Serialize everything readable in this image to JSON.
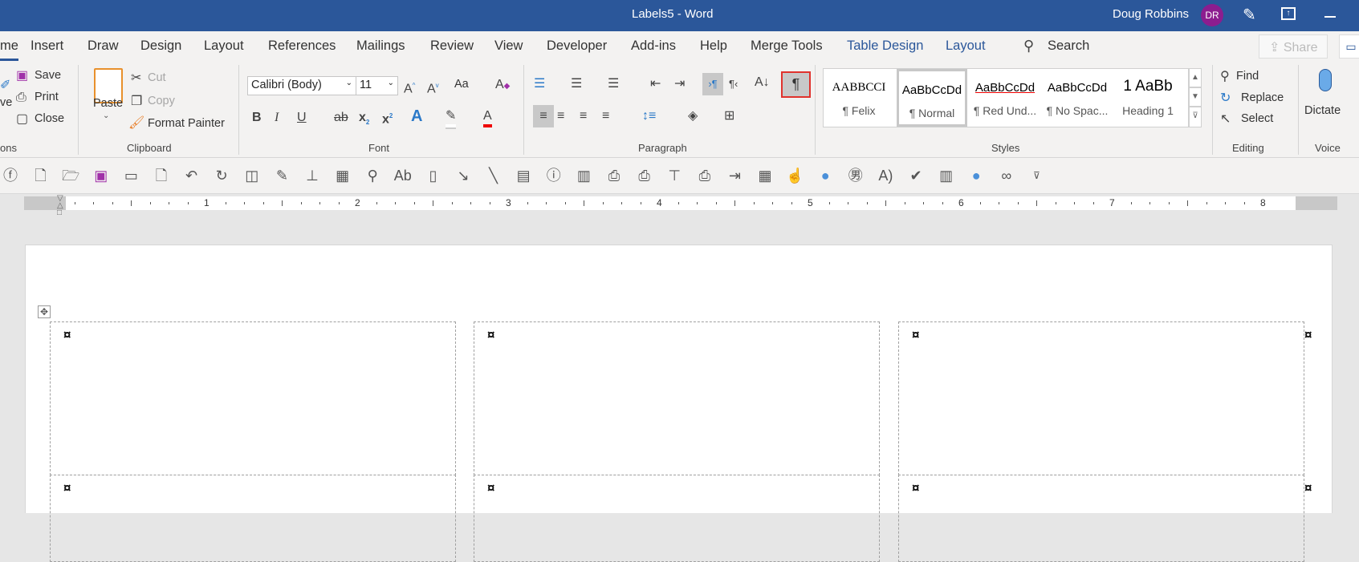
{
  "titlebar": {
    "title": "Labels5  -  Word",
    "user": "Doug Robbins",
    "initials": "DR"
  },
  "tabs": [
    "me",
    "Insert",
    "Draw",
    "Design",
    "Layout",
    "References",
    "Mailings",
    "Review",
    "View",
    "Developer",
    "Add-ins",
    "Help",
    "Merge Tools",
    "Table Design",
    "Layout"
  ],
  "search": "Search",
  "share": "Share",
  "options_group": {
    "partial_label": "ons",
    "partial_btn": "ve",
    "save": "Save",
    "print": "Print",
    "close": "Close"
  },
  "clipboard": {
    "label": "Clipboard",
    "paste": "Paste",
    "cut": "Cut",
    "copy": "Copy",
    "format_painter": "Format Painter"
  },
  "font": {
    "label": "Font",
    "name": "Calibri (Body)",
    "size": "11",
    "change_case": "Aa"
  },
  "paragraph": {
    "label": "Paragraph"
  },
  "styles": {
    "label": "Styles",
    "items": [
      {
        "preview": "AABBCCI",
        "name": "¶ Felix"
      },
      {
        "preview": "AaBbCcDd",
        "name": "¶ Normal"
      },
      {
        "preview": "AaBbCcDd",
        "name": "¶ Red Und..."
      },
      {
        "preview": "AaBbCcDd",
        "name": "¶ No Spac..."
      },
      {
        "preview": "1  AaBb",
        "name": "Heading 1"
      }
    ]
  },
  "editing": {
    "label": "Editing",
    "find": "Find",
    "replace": "Replace",
    "select": "Select"
  },
  "voice": {
    "label": "Voice",
    "dictate": "Dictate"
  },
  "ruler": {
    "numbers": [
      "1",
      "2",
      "3",
      "4",
      "5",
      "6",
      "7",
      "8"
    ]
  },
  "colors": {
    "titlebar": "#2b579a",
    "avatar": "#8c1d8f",
    "highlight_border": "#e0322d"
  },
  "qat_icons": [
    "circle-f-icon",
    "new-doc-icon",
    "open-icon",
    "save-icon",
    "folder-icon",
    "page-icon",
    "undo-icon",
    "redo-icon",
    "shapes-icon",
    "edit-doc-icon",
    "org-chart-icon",
    "table-icon",
    "zoom-icon",
    "spelling-icon",
    "notebook-icon",
    "line-arrow-icon",
    "line-icon",
    "field-icon",
    "info-icon",
    "form-icon",
    "check-print-icon",
    "print-preview-icon",
    "presentation-icon",
    "print-icon",
    "print-arrow-icon",
    "calc-icon",
    "touch-mode-icon",
    "circle-icon",
    "character-icon",
    "read-aloud-icon",
    "check-globe-icon",
    "barcode-icon",
    "circle2-icon",
    "link-icon",
    "customize-qat-icon"
  ]
}
